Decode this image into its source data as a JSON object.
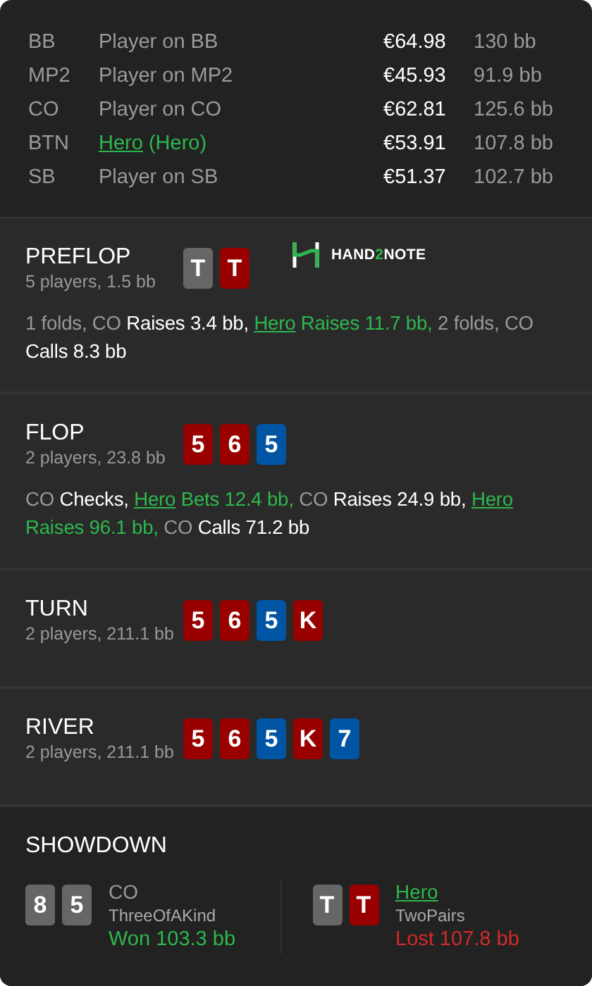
{
  "players": [
    {
      "position": "BB",
      "kind": "plain",
      "name": "Player on BB",
      "stack": "€64.98",
      "bb": "130 bb"
    },
    {
      "position": "MP2",
      "kind": "plain",
      "name": "Player on MP2",
      "stack": "€45.93",
      "bb": "91.9 bb"
    },
    {
      "position": "CO",
      "kind": "plain",
      "name": "Player on CO",
      "stack": "€62.81",
      "bb": "125.6 bb"
    },
    {
      "position": "BTN",
      "kind": "hero",
      "name": "Hero",
      "suffix": "(Hero)",
      "stack": "€53.91",
      "bb": "107.8 bb"
    },
    {
      "position": "SB",
      "kind": "plain",
      "name": "Player on SB",
      "stack": "€51.37",
      "bb": "102.7 bb"
    }
  ],
  "streets": [
    {
      "title": "PREFLOP",
      "info": "5 players, 1.5 bb",
      "cards": [
        {
          "rank": "T",
          "color": "#666666"
        },
        {
          "rank": "T",
          "color": "#990000"
        }
      ],
      "logo": {
        "before": "HAND",
        "accent": "2",
        "after": "NOTE"
      },
      "actions": [
        {
          "kind": "muted",
          "text": "1 folds, CO "
        },
        {
          "kind": "action",
          "text": "Raises 3.4 bb, "
        },
        {
          "kind": "hero_link",
          "text": "Hero"
        },
        {
          "kind": "hero_action",
          "text": " Raises 11.7 bb, "
        },
        {
          "kind": "muted",
          "text": "2 folds, CO "
        },
        {
          "kind": "action",
          "text": "Calls 8.3 bb"
        }
      ]
    },
    {
      "title": "FLOP",
      "info": "2 players, 23.8 bb",
      "cards": [
        {
          "rank": "5",
          "color": "#990000"
        },
        {
          "rank": "6",
          "color": "#990000"
        },
        {
          "rank": "5",
          "color": "#0055a5"
        }
      ],
      "actions": [
        {
          "kind": "muted",
          "text": "CO "
        },
        {
          "kind": "action",
          "text": "Checks, "
        },
        {
          "kind": "hero_link",
          "text": "Hero"
        },
        {
          "kind": "hero_action",
          "text": " Bets 12.4 bb, "
        },
        {
          "kind": "muted",
          "text": "CO "
        },
        {
          "kind": "action",
          "text": "Raises 24.9 bb, "
        },
        {
          "kind": "hero_link",
          "text": "Hero"
        },
        {
          "kind": "hero_action",
          "text": " Raises 96.1 bb, "
        },
        {
          "kind": "muted",
          "text": "CO "
        },
        {
          "kind": "action",
          "text": "Calls 71.2 bb"
        }
      ]
    },
    {
      "title": "TURN",
      "info": "2 players, 211.1 bb",
      "cards": [
        {
          "rank": "5",
          "color": "#990000"
        },
        {
          "rank": "6",
          "color": "#990000"
        },
        {
          "rank": "5",
          "color": "#0055a5"
        },
        {
          "rank": "K",
          "color": "#990000"
        }
      ]
    },
    {
      "title": "RIVER",
      "info": "2 players, 211.1 bb",
      "cards": [
        {
          "rank": "5",
          "color": "#990000"
        },
        {
          "rank": "6",
          "color": "#990000"
        },
        {
          "rank": "5",
          "color": "#0055a5"
        },
        {
          "rank": "K",
          "color": "#990000"
        },
        {
          "rank": "7",
          "color": "#0055a5"
        }
      ]
    }
  ],
  "showdown": {
    "title": "SHOWDOWN",
    "hands": [
      {
        "kind": "plain",
        "cards": [
          {
            "rank": "8",
            "color": "#666666"
          },
          {
            "rank": "5",
            "color": "#666666"
          }
        ],
        "player": "CO",
        "combo": "ThreeOfAKind",
        "result": "Won 103.3 bb",
        "won": true
      },
      {
        "kind": "hero",
        "cards": [
          {
            "rank": "T",
            "color": "#666666"
          },
          {
            "rank": "T",
            "color": "#990000"
          }
        ],
        "player": "Hero",
        "combo": "TwoPairs",
        "result": "Lost 107.8 bb",
        "won": false
      }
    ]
  }
}
